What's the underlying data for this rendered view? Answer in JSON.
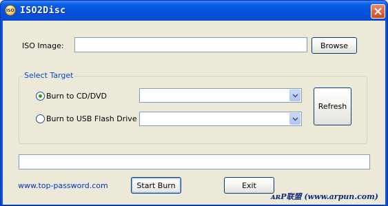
{
  "window": {
    "title": "ISO2Disc",
    "app_icon_text": "ISO"
  },
  "iso": {
    "label": "ISO Image:",
    "value": "",
    "browse_label": "Browse"
  },
  "target": {
    "group_title": "Select Target",
    "cd_label": "Burn to CD/DVD",
    "usb_label": "Burn to USB Flash Drive",
    "cd_selected": true,
    "cd_value": "",
    "usb_value": "",
    "refresh_label": "Refresh"
  },
  "progress": {
    "percent": 0
  },
  "footer": {
    "link": "www.top-password.com",
    "start_label": "Start Burn",
    "exit_label": "Exit",
    "watermark": "ᴀʀP联盟 (www.arpun.com)"
  },
  "colors": {
    "titlebar": "#0550dc",
    "client_bg": "#ece9d8",
    "link": "#0033cc",
    "group_title": "#0046d5"
  }
}
